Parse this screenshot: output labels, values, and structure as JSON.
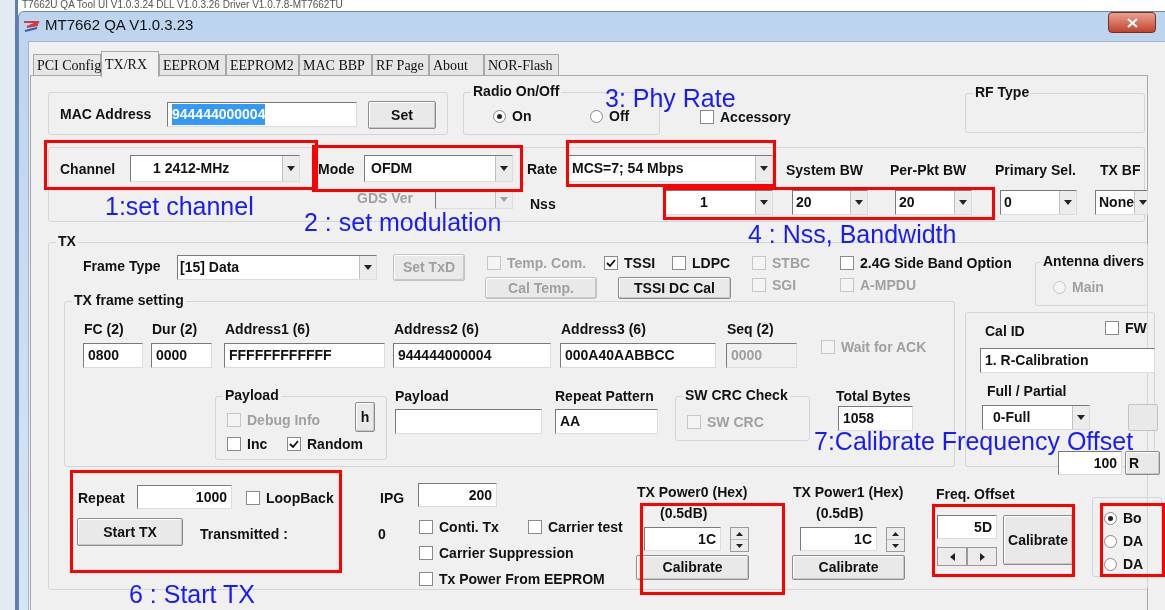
{
  "background_window": {
    "title": "T7662U QA Tool UI V1.0.3.24 DLL V1.0.3.26 Driver V1.0.7.8-MT7662TU"
  },
  "window": {
    "title": "MT7662 QA V1.0.3.23"
  },
  "tabs": [
    {
      "label": "PCI Config",
      "selected": false
    },
    {
      "label": "TX/RX",
      "selected": true
    },
    {
      "label": "EEPROM",
      "selected": false
    },
    {
      "label": "EEPROM2",
      "selected": false
    },
    {
      "label": "MAC  BBP",
      "selected": false
    },
    {
      "label": "RF Page",
      "selected": false
    },
    {
      "label": "About",
      "selected": false
    },
    {
      "label": "NOR-Flash",
      "selected": false
    }
  ],
  "mac_address": {
    "label": "MAC Address",
    "value": "944444000004",
    "button": "Set"
  },
  "radio_on_off": {
    "title": "Radio On/Off",
    "options": [
      {
        "label": "On",
        "selected": true
      },
      {
        "label": "Off",
        "selected": false
      }
    ]
  },
  "accessory": {
    "label": "Accessory",
    "checked": false
  },
  "rf_type": {
    "title": "RF Type"
  },
  "phy_settings": {
    "channel": {
      "label": "Channel",
      "value": "1  2412-MHz"
    },
    "mode": {
      "label": "Mode",
      "value": "OFDM"
    },
    "rate": {
      "label": "Rate",
      "value": "MCS=7; 54 Mbps"
    },
    "gds_ver": {
      "label": "GDS Ver",
      "disabled": true
    },
    "nss": {
      "label": "Nss",
      "value": "1"
    },
    "columns": [
      {
        "label": "System BW",
        "value": "20"
      },
      {
        "label": "Per-Pkt BW",
        "value": "20"
      },
      {
        "label": "Primary Sel.",
        "value": "0"
      },
      {
        "label": "TX BF",
        "value": "None"
      }
    ]
  },
  "tx": {
    "title": "TX",
    "frame_type": {
      "label": "Frame Type",
      "value": "[15] Data"
    },
    "set_txd": {
      "label": "Set TxD",
      "disabled": true
    },
    "options": [
      {
        "label": "Temp. Com.",
        "checked": false,
        "disabled": true
      },
      {
        "label": "TSSI",
        "checked": true,
        "disabled": false
      },
      {
        "label": "LDPC",
        "checked": false,
        "disabled": false
      },
      {
        "label": "STBC",
        "checked": false,
        "disabled": true
      },
      {
        "label": "2.4G Side Band Option",
        "checked": false,
        "disabled": false
      },
      {
        "label": "SGI",
        "checked": false,
        "disabled": true
      },
      {
        "label": "A-MPDU",
        "checked": false,
        "disabled": true
      }
    ],
    "buttons": [
      {
        "label": "Cal Temp.",
        "disabled": true
      },
      {
        "label": "TSSI DC Cal",
        "disabled": false
      }
    ],
    "antenna": {
      "title": "Antenna divers",
      "option": {
        "label": "Main",
        "selected": false,
        "disabled": true
      }
    },
    "frame_setting": {
      "title": "TX frame setting",
      "fields": [
        {
          "label": "FC (2)",
          "value": "0800",
          "disabled": false
        },
        {
          "label": "Dur (2)",
          "value": "0000",
          "disabled": false
        },
        {
          "label": "Address1 (6)",
          "value": "FFFFFFFFFFFF",
          "disabled": false
        },
        {
          "label": "Address2 (6)",
          "value": "944444000004",
          "disabled": false
        },
        {
          "label": "Address3 (6)",
          "value": "000A40AABBCC",
          "disabled": false
        },
        {
          "label": "Seq (2)",
          "value": "0000",
          "disabled": true
        }
      ],
      "wait_for_ack": {
        "label": "Wait for ACK",
        "checked": false,
        "disabled": true
      },
      "payload_group": {
        "title": "Payload",
        "debug_info": {
          "label": "Debug Info",
          "checked": false,
          "disabled": true
        },
        "h_button": "h",
        "inc": {
          "label": "Inc",
          "checked": false,
          "disabled": false
        },
        "random": {
          "label": "Random",
          "checked": true,
          "disabled": false
        }
      },
      "payload": {
        "label": "Payload"
      },
      "repeat_pattern": {
        "label": "Repeat Pattern",
        "value": "AA"
      },
      "sw_crc": {
        "title": "SW CRC Check",
        "option": {
          "label": "SW CRC",
          "checked": false,
          "disabled": true
        }
      },
      "total_bytes": {
        "label": "Total Bytes",
        "value": "1058"
      }
    }
  },
  "calibration": {
    "cal_id_label": "Cal ID",
    "fw": {
      "label": "FW",
      "checked": false,
      "disabled": false
    },
    "cal_id": "1. R-Calibration",
    "full_partial_label": "Full / Partial",
    "full_partial": "0-Full",
    "value": "100",
    "button": "R"
  },
  "run": {
    "repeat": {
      "label": "Repeat",
      "value": "1000"
    },
    "loopback": {
      "label": "LoopBack",
      "checked": false,
      "disabled": false
    },
    "ipg": {
      "label": "IPG",
      "value": "200"
    },
    "start_button": "Start TX",
    "transmitted": {
      "label": "Transmitted :",
      "value": "0"
    },
    "options": [
      {
        "label": "Conti. Tx",
        "checked": false,
        "disabled": false
      },
      {
        "label": "Carrier test",
        "checked": false,
        "disabled": false
      },
      {
        "label": "Carrier Suppression",
        "checked": false,
        "disabled": false
      },
      {
        "label": "Tx Power From EEPROM",
        "checked": false,
        "disabled": false
      }
    ]
  },
  "tx_power": [
    {
      "label": "TX Power0 (Hex)",
      "unit": "(0.5dB)",
      "value": "1C",
      "button": "Calibrate"
    },
    {
      "label": "TX Power1 (Hex)",
      "unit": "(0.5dB)",
      "value": "1C",
      "button": "Calibrate"
    }
  ],
  "freq_offset": {
    "label": "Freq. Offset",
    "value": "5D",
    "button": "Calibrate"
  },
  "output_select": {
    "options": [
      {
        "label": "Bo",
        "selected": true
      },
      {
        "label": "DA",
        "selected": false
      },
      {
        "label": "DA",
        "selected": false
      }
    ]
  },
  "annotations": [
    {
      "text": "1:set channel"
    },
    {
      "text": "2 : set modulation"
    },
    {
      "text": "3: Phy Rate"
    },
    {
      "text": "4 : Nss, Bandwidth"
    },
    {
      "text": "6 : Start TX"
    },
    {
      "text": "7:Calibrate Frequency Offset"
    }
  ]
}
